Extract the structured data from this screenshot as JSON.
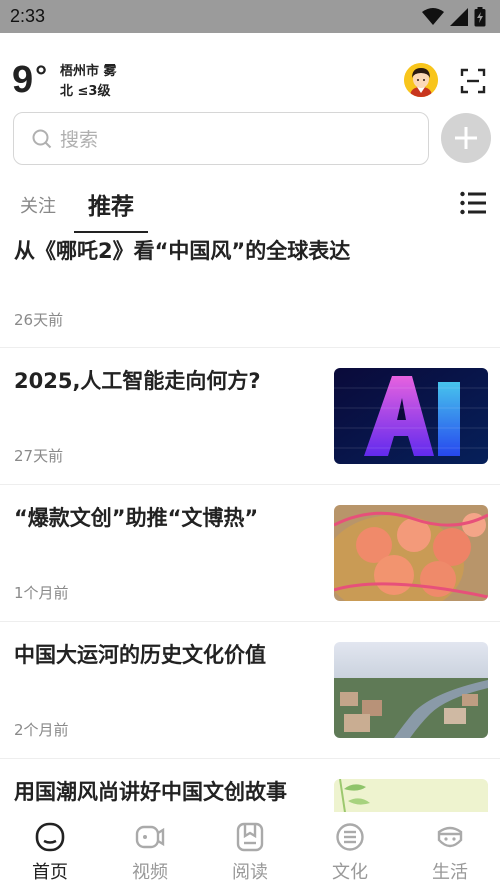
{
  "status_bar": {
    "time": "2:33"
  },
  "weather": {
    "temperature": "9",
    "degree": "°",
    "location_weather": "梧州市 雾",
    "wind": "北 ≤3级"
  },
  "search": {
    "placeholder": "搜索"
  },
  "tabs": [
    {
      "label": "关注",
      "active": false
    },
    {
      "label": "推荐",
      "active": true
    }
  ],
  "articles": [
    {
      "title": "从《哪吒2》看“中国风”的全球表达",
      "time": "26天前",
      "has_thumb": false
    },
    {
      "title": "2025,人工智能走向何方?",
      "time": "27天前",
      "has_thumb": true,
      "thumb_icon": "ai-hologram-image"
    },
    {
      "title": "“爆款文创”助推“文博热”",
      "time": "1个月前",
      "has_thumb": true,
      "thumb_icon": "plush-toys-image"
    },
    {
      "title": "中国大运河的历史文化价值",
      "time": "2个月前",
      "has_thumb": true,
      "thumb_icon": "grand-canal-aerial-image"
    },
    {
      "title": "用国潮风尚讲好中国文创故事",
      "time": "",
      "has_thumb": true,
      "thumb_icon": "bamboo-image"
    }
  ],
  "bottom_nav": [
    {
      "label": "首页",
      "icon": "home-icon",
      "active": true
    },
    {
      "label": "视频",
      "icon": "video-icon",
      "active": false
    },
    {
      "label": "阅读",
      "icon": "read-icon",
      "active": false
    },
    {
      "label": "文化",
      "icon": "culture-icon",
      "active": false
    },
    {
      "label": "生活",
      "icon": "life-icon",
      "active": false
    }
  ],
  "colors": {
    "status_bar": "#9b9b9b",
    "text_primary": "#222222",
    "text_secondary": "#8a8a8a",
    "nav_inactive": "#999999",
    "add_button": "#d3d3d3",
    "avatar_bg": "#f8c51c"
  }
}
